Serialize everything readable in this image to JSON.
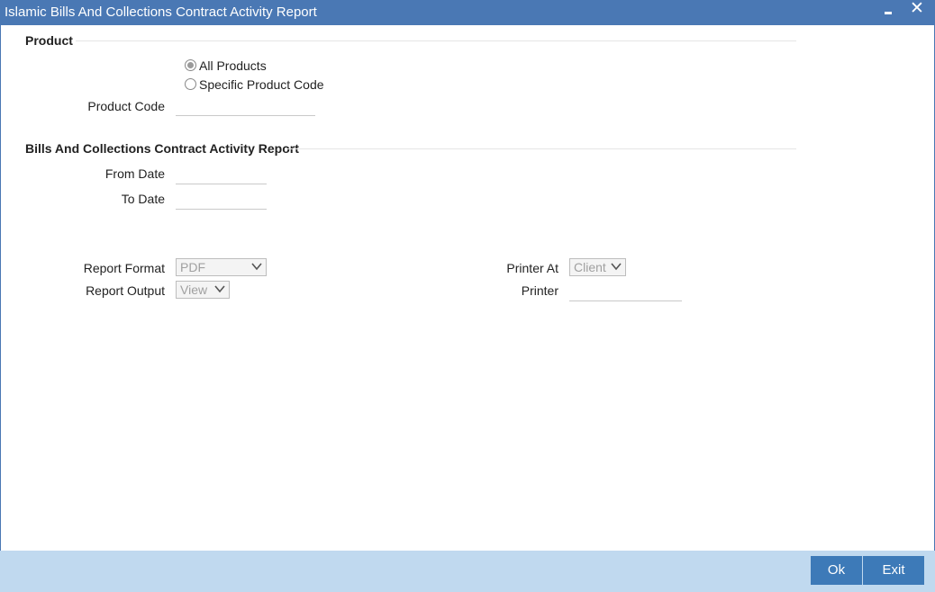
{
  "window": {
    "title": "Islamic Bills And Collections Contract Activity Report",
    "minimize_icon": "minimize-icon",
    "close_glyph": "✕"
  },
  "product_section": {
    "title": "Product",
    "options": [
      "All Products",
      "Specific Product Code"
    ],
    "selected": "All Products",
    "product_code_label": "Product Code",
    "product_code_value": ""
  },
  "activity_section": {
    "title": "Bills And Collections Contract Activity Report",
    "from_date_label": "From Date",
    "from_date_value": "",
    "to_date_label": "To Date",
    "to_date_value": ""
  },
  "report_options": {
    "report_format_label": "Report Format",
    "report_format_value": "PDF",
    "report_output_label": "Report Output",
    "report_output_value": "View",
    "printer_at_label": "Printer At",
    "printer_at_value": "Client",
    "printer_label": "Printer",
    "printer_value": ""
  },
  "footer": {
    "ok_label": "Ok",
    "exit_label": "Exit"
  },
  "colors": {
    "titlebar": "#4a78b4",
    "footer": "#c0d9ef",
    "button": "#3d7ab8"
  }
}
